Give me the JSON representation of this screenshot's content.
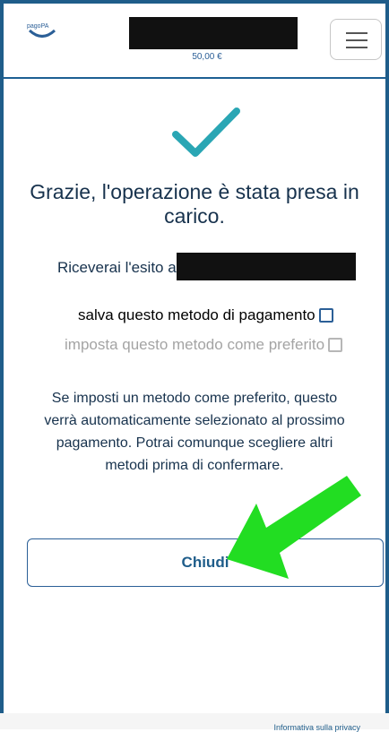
{
  "header": {
    "logo": "pagoPA",
    "amount": "50,00 €",
    "menu_icon": "hamburger-icon"
  },
  "confirmation": {
    "title": "Grazie, l'operazione è stata presa in carico.",
    "receive_label": "Riceverai l'esito a"
  },
  "options": {
    "save_method": "salva questo metodo di pagamento",
    "set_preferred": "imposta questo metodo come preferito"
  },
  "info_text": "Se imposti un metodo come preferito, questo verrà automaticamente selezionato al prossimo pagamento. Potrai comunque scegliere altri metodi prima di confermare.",
  "buttons": {
    "close": "Chiudi"
  },
  "footer": {
    "privacy_link": "Informativa sulla privacy"
  },
  "colors": {
    "primary": "#1f5d8a",
    "text": "#17324d",
    "success": "#2aa6b4",
    "annotation_arrow": "#22dd22"
  }
}
